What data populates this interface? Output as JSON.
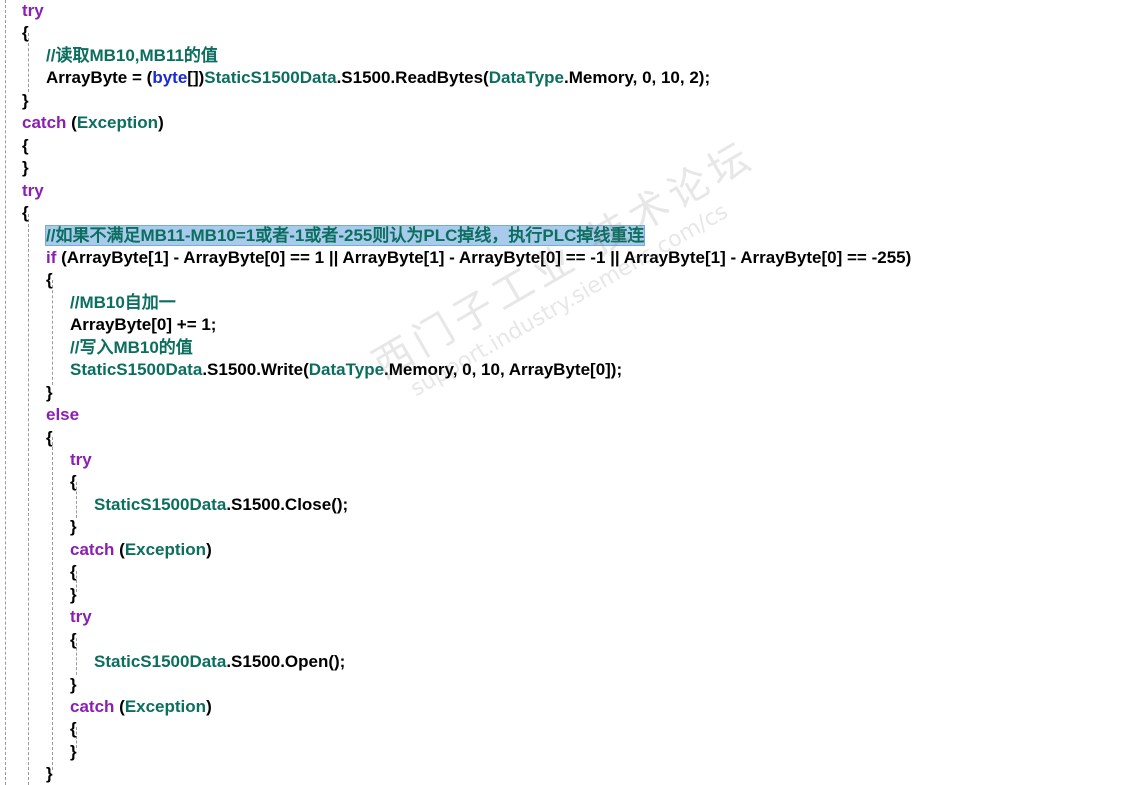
{
  "colors": {
    "keyword": "#8b1fb3",
    "type": "#0b6e5e",
    "builtin_type": "#1a2bd6",
    "comment": "#0b6e5e",
    "plain": "#000000",
    "selection": "#a8cbec"
  },
  "watermark": {
    "line1": "西门子工业 技术论坛",
    "line2": "support.industry.siemens.com/cs"
  },
  "lines": [
    {
      "indent": 0,
      "parts": [
        {
          "t": "try",
          "c": "kw"
        }
      ]
    },
    {
      "indent": 0,
      "parts": [
        {
          "t": "{",
          "c": "plain"
        }
      ]
    },
    {
      "indent": 1,
      "parts": [
        {
          "t": "//读取MB10,MB11的值",
          "c": "cmt"
        }
      ]
    },
    {
      "indent": 1,
      "parts": [
        {
          "t": "ArrayByte = (",
          "c": "plain"
        },
        {
          "t": "byte",
          "c": "blu"
        },
        {
          "t": "[])",
          "c": "plain"
        },
        {
          "t": "StaticS1500Data",
          "c": "typ"
        },
        {
          "t": ".S1500.ReadBytes(",
          "c": "plain"
        },
        {
          "t": "DataType",
          "c": "typ"
        },
        {
          "t": ".Memory, 0, 10, 2);",
          "c": "plain"
        }
      ]
    },
    {
      "indent": 0,
      "parts": [
        {
          "t": "}",
          "c": "plain"
        }
      ]
    },
    {
      "indent": 0,
      "parts": [
        {
          "t": "catch",
          "c": "kw"
        },
        {
          "t": " (",
          "c": "plain"
        },
        {
          "t": "Exception",
          "c": "typ"
        },
        {
          "t": ")",
          "c": "plain"
        }
      ]
    },
    {
      "indent": 0,
      "parts": [
        {
          "t": "{",
          "c": "plain"
        }
      ]
    },
    {
      "indent": 0,
      "parts": [
        {
          "t": "}",
          "c": "plain"
        }
      ]
    },
    {
      "indent": 0,
      "parts": [
        {
          "t": "try",
          "c": "kw"
        }
      ]
    },
    {
      "indent": 0,
      "parts": [
        {
          "t": "{",
          "c": "plain"
        }
      ]
    },
    {
      "indent": 1,
      "highlight": true,
      "parts": [
        {
          "t": "//如果不满足MB11-MB10=1或者-1或者-255则认为PLC掉线，执行PLC掉线重连",
          "c": "cmt"
        }
      ]
    },
    {
      "indent": 1,
      "parts": [
        {
          "t": "if",
          "c": "kw"
        },
        {
          "t": " (ArrayByte[1] - ArrayByte[0] == 1 || ArrayByte[1] - ArrayByte[0] == -1 || ArrayByte[1] - ArrayByte[0] == -255)",
          "c": "plain"
        }
      ]
    },
    {
      "indent": 1,
      "parts": [
        {
          "t": "{",
          "c": "plain"
        }
      ]
    },
    {
      "indent": 2,
      "parts": [
        {
          "t": "//MB10自加一",
          "c": "cmt"
        }
      ]
    },
    {
      "indent": 2,
      "parts": [
        {
          "t": "ArrayByte[0] += 1;",
          "c": "plain"
        }
      ]
    },
    {
      "indent": 2,
      "parts": [
        {
          "t": "//写入MB10的值",
          "c": "cmt"
        }
      ]
    },
    {
      "indent": 2,
      "parts": [
        {
          "t": "StaticS1500Data",
          "c": "typ"
        },
        {
          "t": ".S1500.Write(",
          "c": "plain"
        },
        {
          "t": "DataType",
          "c": "typ"
        },
        {
          "t": ".Memory, 0, 10, ArrayByte[0]);",
          "c": "plain"
        }
      ]
    },
    {
      "indent": 1,
      "parts": [
        {
          "t": "}",
          "c": "plain"
        }
      ]
    },
    {
      "indent": 1,
      "parts": [
        {
          "t": "else",
          "c": "kw"
        }
      ]
    },
    {
      "indent": 1,
      "parts": [
        {
          "t": "{",
          "c": "plain"
        }
      ]
    },
    {
      "indent": 2,
      "parts": [
        {
          "t": "try",
          "c": "kw"
        }
      ]
    },
    {
      "indent": 2,
      "parts": [
        {
          "t": "{",
          "c": "plain"
        }
      ]
    },
    {
      "indent": 3,
      "parts": [
        {
          "t": "StaticS1500Data",
          "c": "typ"
        },
        {
          "t": ".S1500.Close();",
          "c": "plain"
        }
      ]
    },
    {
      "indent": 2,
      "parts": [
        {
          "t": "}",
          "c": "plain"
        }
      ]
    },
    {
      "indent": 2,
      "parts": [
        {
          "t": "catch",
          "c": "kw"
        },
        {
          "t": " (",
          "c": "plain"
        },
        {
          "t": "Exception",
          "c": "typ"
        },
        {
          "t": ")",
          "c": "plain"
        }
      ]
    },
    {
      "indent": 2,
      "parts": [
        {
          "t": "{",
          "c": "plain"
        }
      ]
    },
    {
      "indent": 2,
      "parts": [
        {
          "t": "}",
          "c": "plain"
        }
      ]
    },
    {
      "indent": 2,
      "parts": [
        {
          "t": "try",
          "c": "kw"
        }
      ]
    },
    {
      "indent": 2,
      "parts": [
        {
          "t": "{",
          "c": "plain"
        }
      ]
    },
    {
      "indent": 3,
      "parts": [
        {
          "t": "StaticS1500Data",
          "c": "typ"
        },
        {
          "t": ".S1500.Open();",
          "c": "plain"
        }
      ]
    },
    {
      "indent": 2,
      "parts": [
        {
          "t": "}",
          "c": "plain"
        }
      ]
    },
    {
      "indent": 2,
      "parts": [
        {
          "t": "catch",
          "c": "kw"
        },
        {
          "t": " (",
          "c": "plain"
        },
        {
          "t": "Exception",
          "c": "typ"
        },
        {
          "t": ")",
          "c": "plain"
        }
      ]
    },
    {
      "indent": 2,
      "parts": [
        {
          "t": "{",
          "c": "plain"
        }
      ]
    },
    {
      "indent": 2,
      "parts": [
        {
          "t": "}",
          "c": "plain"
        }
      ]
    },
    {
      "indent": 1,
      "parts": [
        {
          "t": "}",
          "c": "plain"
        }
      ]
    }
  ]
}
